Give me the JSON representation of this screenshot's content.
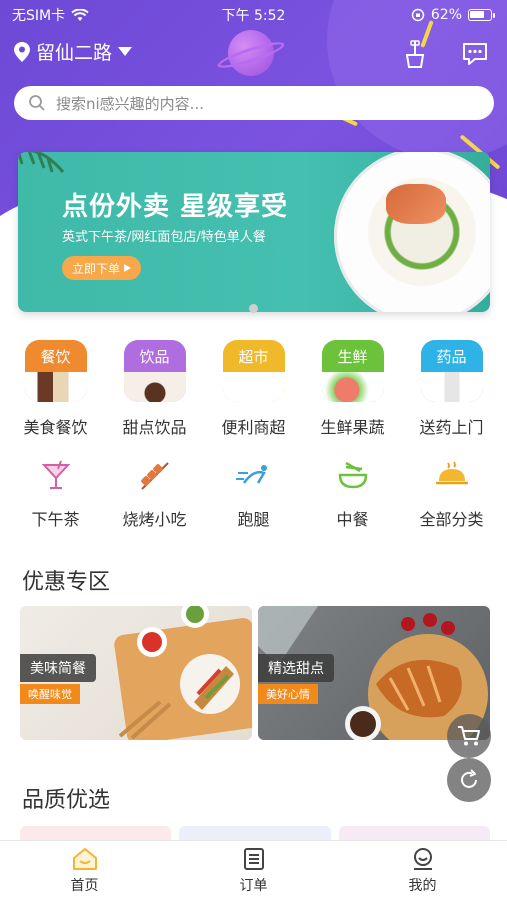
{
  "status_bar": {
    "carrier": "无SIM卡",
    "time": "下午 5:52",
    "battery": "62%"
  },
  "header": {
    "location": "留仙二路"
  },
  "search": {
    "placeholder": "搜索ni感兴趣的内容..."
  },
  "banner": {
    "title": "点份外卖  星级享受",
    "subtitle": "英式下午茶/网红面包店/特色单人餐",
    "button": "立即下单"
  },
  "categories": [
    {
      "tag": "餐饮",
      "label": "美食餐饮",
      "color": "#f08a2e"
    },
    {
      "tag": "饮品",
      "label": "甜点饮品",
      "color": "#b06de0"
    },
    {
      "tag": "超市",
      "label": "便利商超",
      "color": "#f0b92a"
    },
    {
      "tag": "生鲜",
      "label": "生鲜果蔬",
      "color": "#6dc23c"
    },
    {
      "tag": "药品",
      "label": "送药上门",
      "color": "#2fb3e6"
    }
  ],
  "sub_categories": [
    {
      "label": "下午茶",
      "icon": "cocktail-icon"
    },
    {
      "label": "烧烤小吃",
      "icon": "skewer-icon"
    },
    {
      "label": "跑腿",
      "icon": "running-icon"
    },
    {
      "label": "中餐",
      "icon": "bowl-icon"
    },
    {
      "label": "全部分类",
      "icon": "dish-icon"
    }
  ],
  "deals": {
    "title": "优惠专区",
    "cards": [
      {
        "name": "美味简餐",
        "tag": "唤醒味觉"
      },
      {
        "name": "精选甜点",
        "tag": "美好心情"
      }
    ]
  },
  "quality": {
    "title": "品质优选"
  },
  "tabbar": {
    "items": [
      {
        "label": "首页",
        "icon": "home-icon"
      },
      {
        "label": "订单",
        "icon": "order-list-icon"
      },
      {
        "label": "我的",
        "icon": "profile-icon"
      }
    ]
  },
  "colors": {
    "header_purple": "#6d49d6",
    "banner_teal": "#3fb9a8",
    "accent_orange": "#f28a1b",
    "active_tab_yellow": "#f2b630"
  }
}
